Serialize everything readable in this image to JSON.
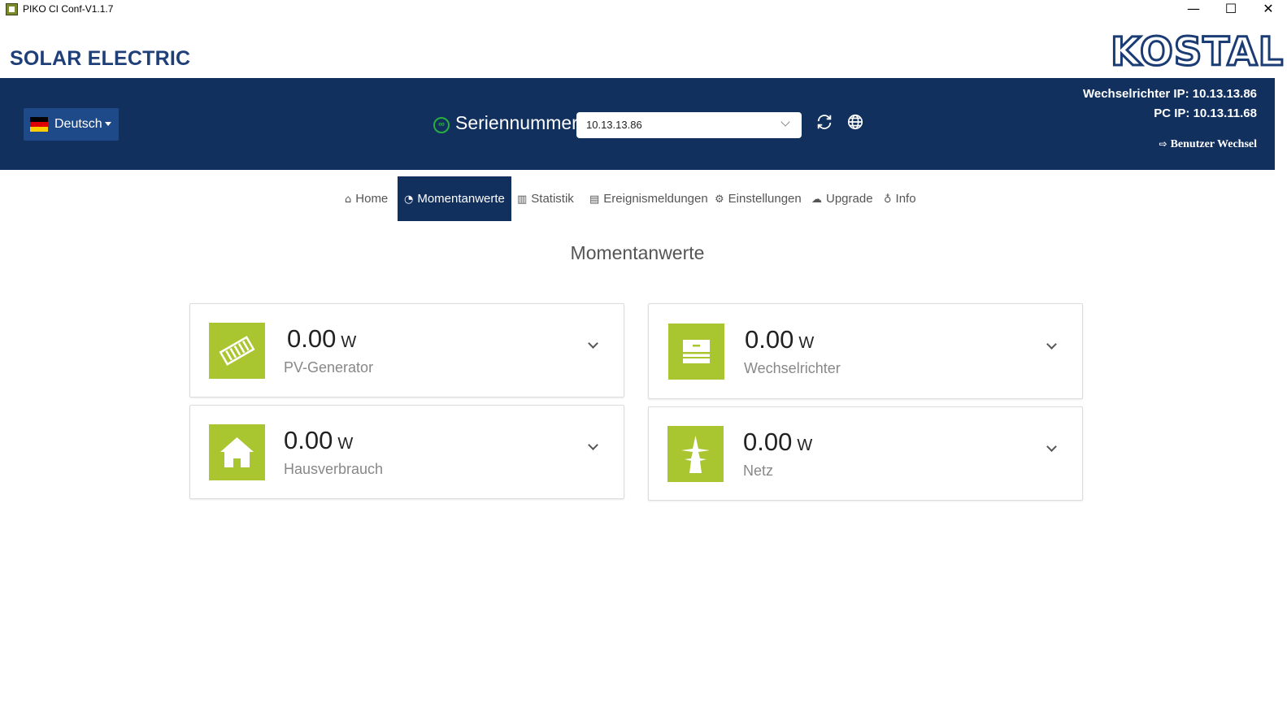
{
  "window": {
    "title": "PIKO CI Conf-V1.1.7",
    "minimize": "—",
    "maximize": "☐",
    "close": "✕"
  },
  "brand": {
    "name": "SOLAR ELECTRIC",
    "logo_text": "KOSTAL"
  },
  "header": {
    "language": "Deutsch",
    "serial_label": "Seriennummer:",
    "serial_value": "10.13.13.86",
    "inverter_ip": "Wechselrichter IP: 10.13.13.86",
    "pc_ip": "PC IP: 10.13.11.68",
    "user_switch": "Benutzer Wechsel",
    "colors": {
      "header_bg": "#11305e",
      "lang_bg": "#1e4a8a",
      "connected": "#27ae3f"
    }
  },
  "nav": {
    "items": [
      {
        "label": "Home",
        "icon": "home-icon"
      },
      {
        "label": "Momentanwerte",
        "icon": "dashboard-icon",
        "active": true
      },
      {
        "label": "Statistik",
        "icon": "bar-chart-icon"
      },
      {
        "label": "Ereignismeldungen",
        "icon": "document-icon"
      },
      {
        "label": "Einstellungen",
        "icon": "gear-icon"
      },
      {
        "label": "Upgrade",
        "icon": "cloud-upload-icon"
      },
      {
        "label": "Info",
        "icon": "lightbulb-icon"
      }
    ]
  },
  "main": {
    "title": "Momentanwerte",
    "accent": "#a9c52f",
    "cards": [
      {
        "value": "0.00",
        "unit": "W",
        "label": "PV-Generator",
        "icon": "solar-panel-icon"
      },
      {
        "value": "0.00",
        "unit": "W",
        "label": "Wechselrichter",
        "icon": "inverter-icon"
      },
      {
        "value": "0.00",
        "unit": "W",
        "label": "Hausverbrauch",
        "icon": "house-icon"
      },
      {
        "value": "0.00",
        "unit": "W",
        "label": "Netz",
        "icon": "power-pylon-icon"
      }
    ]
  }
}
